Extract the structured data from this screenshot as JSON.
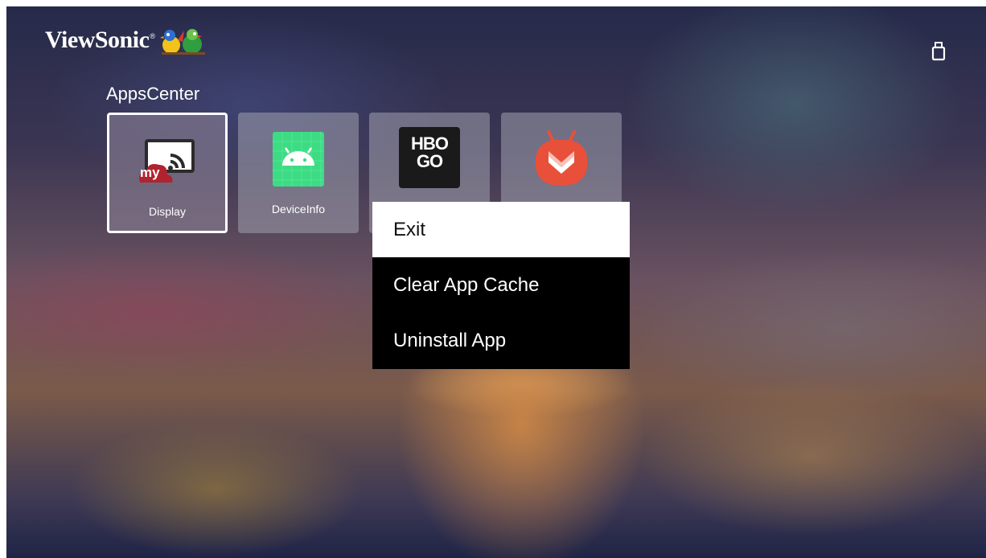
{
  "brand": {
    "name": "ViewSonic",
    "registered": "®"
  },
  "status_icons": [
    {
      "icon": "usb-icon",
      "color": "#ffffff"
    }
  ],
  "section": {
    "title": "AppsCenter"
  },
  "apps": [
    {
      "label": "Display",
      "icon": "mydisplay-icon",
      "icon_text": "my",
      "focused": true
    },
    {
      "label": "DeviceInfo",
      "icon": "android-icon",
      "focused": false
    },
    {
      "label": "",
      "icon": "hbo-go-icon",
      "icon_text_top": "HBO",
      "icon_text_bottom": "GO",
      "focused": false
    },
    {
      "label": "",
      "icon": "aptoide-tv-icon",
      "focused": false
    }
  ],
  "context_menu": {
    "items": [
      {
        "label": "Exit",
        "selected": true
      },
      {
        "label": "Clear App Cache",
        "selected": false
      },
      {
        "label": "Uninstall App",
        "selected": false
      }
    ]
  },
  "colors": {
    "menu_background": "#000000",
    "menu_selected_background": "#ffffff",
    "android_green": "#3ddc84",
    "mydisplay_red": "#b0232f",
    "aptoide_orange": "#e8503a"
  }
}
